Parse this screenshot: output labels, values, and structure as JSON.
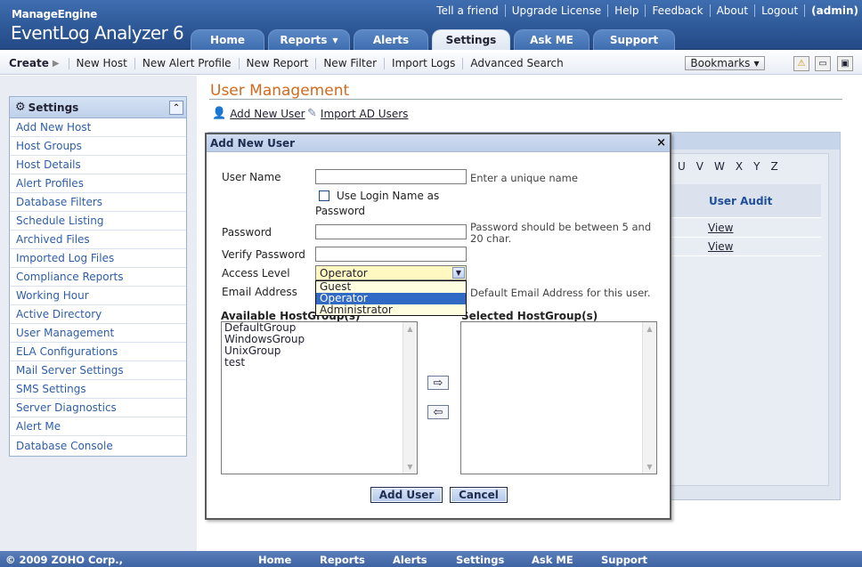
{
  "brand": {
    "company": "ManageEngine",
    "product": "EventLog Analyzer 6"
  },
  "top_links": [
    "Tell a friend",
    "Upgrade License",
    "Help",
    "Feedback",
    "About",
    "Logout"
  ],
  "user": "(admin)",
  "tabs": [
    {
      "label": "Home",
      "active": false
    },
    {
      "label": "Reports",
      "active": false,
      "dropdown": true
    },
    {
      "label": "Alerts",
      "active": false
    },
    {
      "label": "Settings",
      "active": true
    },
    {
      "label": "Ask ME",
      "active": false
    },
    {
      "label": "Support",
      "active": false
    }
  ],
  "toolbar": {
    "create_label": "Create",
    "links": [
      "New Host",
      "New Alert Profile",
      "New Report",
      "New Filter",
      "Import Logs",
      "Advanced Search"
    ],
    "bookmarks_label": "Bookmarks"
  },
  "sidebar": {
    "title": "Settings",
    "items": [
      "Add New Host",
      "Host Groups",
      "Host Details",
      "Alert Profiles",
      "Database Filters",
      "Schedule Listing",
      "Archived Files",
      "Imported Log Files",
      "Compliance Reports",
      "Working Hour",
      "Active Directory",
      "User Management",
      "ELA Configurations",
      "Mail Server Settings",
      "SMS Settings",
      "Server Diagnostics",
      "Alert Me",
      "Database Console"
    ]
  },
  "main": {
    "title": "User Management",
    "add_user_link": "Add New User",
    "import_ad_link": "Import AD Users",
    "alphabet": [
      "U",
      "V",
      "W",
      "X",
      "Y",
      "Z"
    ],
    "user_audit_header": "User Audit",
    "view_links": [
      "View",
      "View"
    ]
  },
  "modal": {
    "title": "Add New User",
    "close": "×",
    "user_name_label": "User Name",
    "user_name_hint": "Enter a unique name",
    "use_login_label": "Use Login Name as",
    "use_login_label2": "Password",
    "password_label": "Password",
    "password_hint1": "Password should be between 5 and",
    "password_hint2": "20 char.",
    "verify_label": "Verify Password",
    "access_label": "Access Level",
    "access_value": "Operator",
    "access_options": [
      "Guest",
      "Operator",
      "Administrator"
    ],
    "email_label": "Email Address",
    "email_hint": "Default Email Address for this user.",
    "available_label": "Available HostGroup(s)",
    "selected_label": "Selected HostGroup(s)",
    "available_groups": [
      "DefaultGroup",
      "WindowsGroup",
      "UnixGroup",
      "test"
    ],
    "move_right": "⇨",
    "move_left": "⇦",
    "add_button": "Add User",
    "cancel_button": "Cancel"
  },
  "footer": {
    "copyright": "© 2009 ZOHO Corp.,",
    "links": [
      "Home",
      "Reports",
      "Alerts",
      "Settings",
      "Ask ME",
      "Support"
    ]
  }
}
